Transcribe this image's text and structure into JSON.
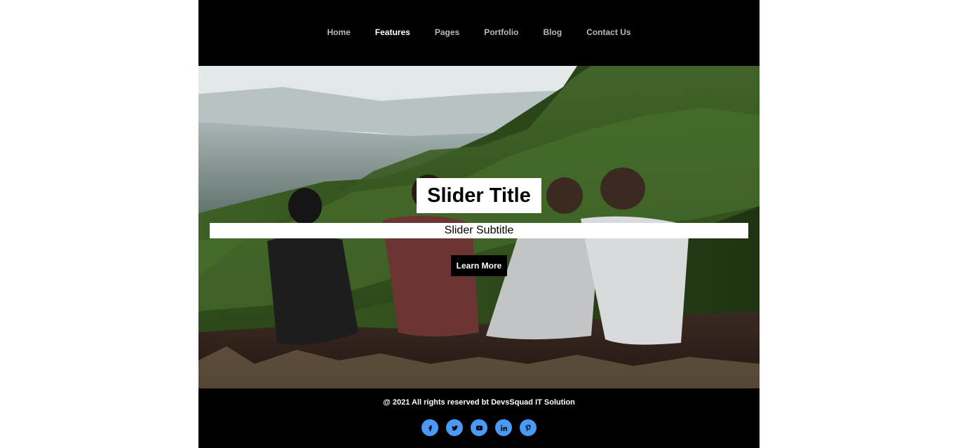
{
  "nav": {
    "items": [
      {
        "label": "Home",
        "active": false
      },
      {
        "label": "Features",
        "active": true
      },
      {
        "label": "Pages",
        "active": false
      },
      {
        "label": "Portfolio",
        "active": false
      },
      {
        "label": "Blog",
        "active": false
      },
      {
        "label": "Contact Us",
        "active": false
      }
    ]
  },
  "hero": {
    "title": "Slider Title",
    "subtitle": "Slider Subtitle",
    "button_label": "Learn More"
  },
  "footer": {
    "copyright": "@ 2021 All rights reserved bt DevsSquad IT Solution",
    "socials": [
      "facebook-icon",
      "twitter-icon",
      "youtube-icon",
      "linkedin-icon",
      "pinterest-icon"
    ]
  },
  "colors": {
    "background": "#000000",
    "social_accent": "#4a9af5",
    "nav_text": "#b9b9b9",
    "nav_active": "#ffffff"
  }
}
